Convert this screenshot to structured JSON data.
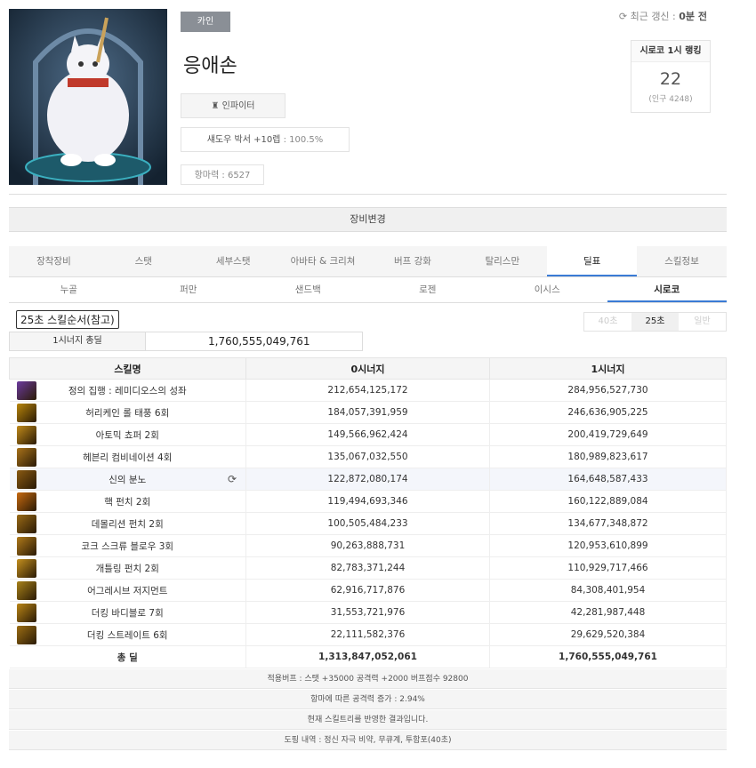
{
  "profile": {
    "server": "카인",
    "name": "응애손",
    "job": "인파이터",
    "weapon_name": "섀도우 박서 +10렙",
    "weapon_sub": "100.5%",
    "adven_label": "항마력",
    "adven_value": "6527",
    "update_label": "최근 갱신 : ",
    "update_value": "0분 전"
  },
  "ranking": {
    "title": "시로코 1시 랭킹",
    "value": "22",
    "population": "(인구 4248)"
  },
  "equip_change": "장비변경",
  "tabs": [
    "장착장비",
    "스탯",
    "세부스탯",
    "아바타 & 크리쳐",
    "버프 강화",
    "탈리스만",
    "딜표",
    "스킬정보"
  ],
  "active_tab": 6,
  "subtabs": [
    "누골",
    "퍼만",
    "샌드백",
    "로젠",
    "이시스",
    "시로코"
  ],
  "active_subtab": 5,
  "skill_order_label": "25초 스킬순서(참고)",
  "time_tabs": [
    "40초",
    "25초",
    "일반"
  ],
  "active_time_tab": 1,
  "synergy": {
    "label": "1시너지 총딜",
    "value": "1,760,555,049,761"
  },
  "table": {
    "headers": [
      "스킬명",
      "0시너지",
      "1시너지"
    ],
    "rows": [
      {
        "name": "정의 집행 : 레미디오스의 성좌",
        "s0": "212,654,125,172",
        "s1": "284,956,527,730",
        "icon": "#6b3a9e"
      },
      {
        "name": "허리케인 롤 태풍 6회",
        "s0": "184,057,391,959",
        "s1": "246,636,905,225",
        "icon": "#b8860b"
      },
      {
        "name": "아토믹 쵸퍼 2회",
        "s0": "149,566,962,424",
        "s1": "200,419,729,649",
        "icon": "#c08a1a"
      },
      {
        "name": "헤븐리 컴비네이션 4회",
        "s0": "135,067,032,550",
        "s1": "180,989,823,617",
        "icon": "#a9731a"
      },
      {
        "name": "신의 분노",
        "s0": "122,872,080,174",
        "s1": "164,648,587,433",
        "icon": "#8a5a12"
      },
      {
        "name": "핵 펀치 2회",
        "s0": "119,494,693,346",
        "s1": "160,122,889,084",
        "icon": "#c76a10"
      },
      {
        "name": "데몰리션 펀치 2회",
        "s0": "100,505,484,233",
        "s1": "134,677,348,872",
        "icon": "#9a6a16"
      },
      {
        "name": "코크 스크류 블로우 3회",
        "s0": "90,263,888,731",
        "s1": "120,953,610,899",
        "icon": "#b07a1a"
      },
      {
        "name": "개틀링 펀치 2회",
        "s0": "82,783,371,244",
        "s1": "110,929,717,466",
        "icon": "#c4901e"
      },
      {
        "name": "어그레시브 저지먼트",
        "s0": "62,916,717,876",
        "s1": "84,308,401,954",
        "icon": "#a8821a"
      },
      {
        "name": "더킹 바디블로 7회",
        "s0": "31,553,721,976",
        "s1": "42,281,987,448",
        "icon": "#b98516"
      },
      {
        "name": "더킹 스트레이트 6회",
        "s0": "22,111,582,376",
        "s1": "29,629,520,384",
        "icon": "#9c6e14"
      }
    ],
    "total": {
      "name": "총 딜",
      "s0": "1,313,847,052,061",
      "s1": "1,760,555,049,761"
    }
  },
  "notes": [
    "적용버프 : 스탯 +35000 공격력 +2000 버프점수 92800",
    "항마에 따른 공격력 증가 : 2.94%",
    "현재 스킬트리를 반영한 결과입니다.",
    "도핑 내역 : 정신 자극 비약, 무큐계, 투함포(40초)"
  ]
}
